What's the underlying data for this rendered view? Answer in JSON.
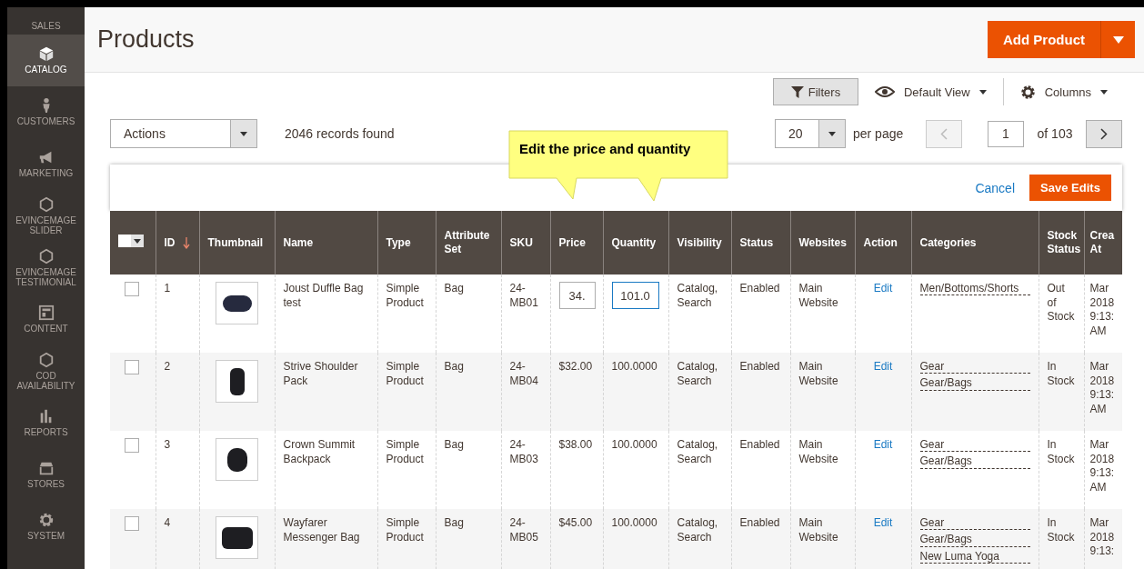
{
  "sidebar": {
    "items": [
      {
        "label": "SALES",
        "selected": false
      },
      {
        "label": "CATALOG",
        "selected": true
      },
      {
        "label": "CUSTOMERS",
        "selected": false
      },
      {
        "label": "MARKETING",
        "selected": false
      },
      {
        "label": "EVINCEMAGE SLIDER",
        "selected": false
      },
      {
        "label": "EVINCEMAGE TESTIMONIAL",
        "selected": false
      },
      {
        "label": "CONTENT",
        "selected": false
      },
      {
        "label": "COD AVAILABILITY",
        "selected": false
      },
      {
        "label": "REPORTS",
        "selected": false
      },
      {
        "label": "STORES",
        "selected": false
      },
      {
        "label": "SYSTEM",
        "selected": false
      }
    ]
  },
  "page": {
    "title": "Products",
    "primary_button": "Add Product"
  },
  "toolbar": {
    "filters": "Filters",
    "view": "Default View",
    "columns": "Columns"
  },
  "grid_controls": {
    "actions": "Actions",
    "records": "2046 records found",
    "per_page_value": "20",
    "per_page_label": "per page",
    "page_value": "1",
    "page_total": "of 103"
  },
  "edit_bar": {
    "cancel": "Cancel",
    "save": "Save Edits"
  },
  "callout": {
    "text": "Edit the price and quantity"
  },
  "table": {
    "columns": [
      {
        "kind": "select"
      },
      {
        "label": "ID",
        "kind": "text",
        "sorted": true
      },
      {
        "label": "Thumbnail",
        "kind": "text",
        "sorted": false
      },
      {
        "label": "Name",
        "kind": "text",
        "sorted": false
      },
      {
        "label": "Type",
        "kind": "text",
        "sorted": false
      },
      {
        "label": "Attribute Set",
        "kind": "text",
        "sorted": false
      },
      {
        "label": "SKU",
        "kind": "text",
        "sorted": false
      },
      {
        "label": "Price",
        "kind": "text",
        "sorted": false
      },
      {
        "label": "Quantity",
        "kind": "text",
        "sorted": false
      },
      {
        "label": "Visibility",
        "kind": "text",
        "sorted": false
      },
      {
        "label": "Status",
        "kind": "text",
        "sorted": false
      },
      {
        "label": "Websites",
        "kind": "text",
        "sorted": false
      },
      {
        "label": "Action",
        "kind": "text",
        "sorted": false
      },
      {
        "label": "Categories",
        "kind": "text",
        "sorted": false
      },
      {
        "label": "Stock Status",
        "kind": "text",
        "sorted": false
      },
      {
        "label": "Crea At",
        "kind": "text",
        "sorted": false
      }
    ],
    "rows": [
      {
        "checked": false,
        "id": "1",
        "name": "Joust Duffle Bag test",
        "type": "Simple Product",
        "attribute_set": "Bag",
        "sku": "24-MB01",
        "price_input": {
          "value": "34.",
          "focused": false
        },
        "quantity_input": {
          "value": "101.0",
          "focused": true
        },
        "visibility": "Catalog, Search",
        "status": "Enabled",
        "websites": "Main Website",
        "action": "Edit",
        "categories": [
          "Men/Bottoms/Shorts"
        ],
        "stock": "Out of Stock",
        "created": "Mar 2018 9:13: AM"
      },
      {
        "checked": false,
        "id": "2",
        "name": "Strive Shoulder Pack",
        "type": "Simple Product",
        "attribute_set": "Bag",
        "sku": "24-MB04",
        "price": "$32.00",
        "quantity": "100.0000",
        "visibility": "Catalog, Search",
        "status": "Enabled",
        "websites": "Main Website",
        "action": "Edit",
        "categories": [
          "Gear",
          "Gear/Bags"
        ],
        "stock": "In Stock",
        "created": "Mar 2018 9:13: AM"
      },
      {
        "checked": false,
        "id": "3",
        "name": "Crown Summit Backpack",
        "type": "Simple Product",
        "attribute_set": "Bag",
        "sku": "24-MB03",
        "price": "$38.00",
        "quantity": "100.0000",
        "visibility": "Catalog, Search",
        "status": "Enabled",
        "websites": "Main Website",
        "action": "Edit",
        "categories": [
          "Gear",
          "Gear/Bags"
        ],
        "stock": "In Stock",
        "created": "Mar 2018 9:13: AM"
      },
      {
        "checked": false,
        "id": "4",
        "name": "Wayfarer Messenger Bag",
        "type": "Simple Product",
        "attribute_set": "Bag",
        "sku": "24-MB05",
        "price": "$45.00",
        "quantity": "100.0000",
        "visibility": "Catalog, Search",
        "status": "Enabled",
        "websites": "Main Website",
        "action": "Edit",
        "categories": [
          "Gear",
          "Gear/Bags",
          "New Luma Yoga"
        ],
        "stock": "In Stock",
        "created": "Mar 2018 9:13:"
      }
    ]
  }
}
